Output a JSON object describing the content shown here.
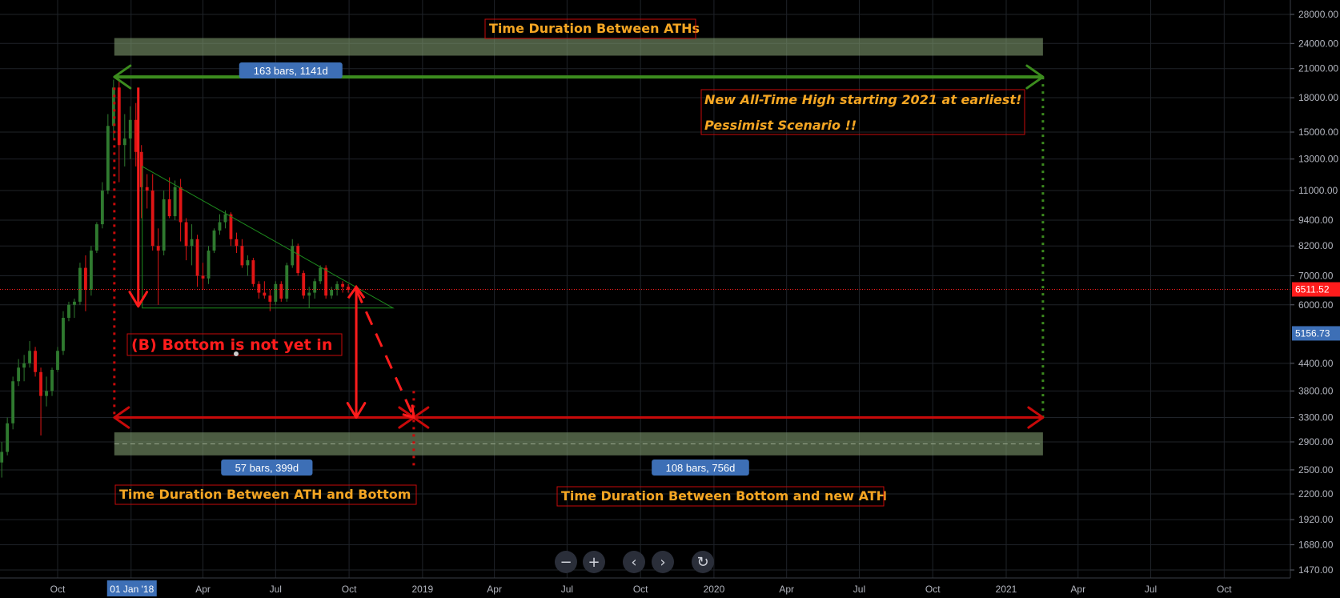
{
  "chart_data": {
    "type": "candlestick",
    "y_scale": "log",
    "ylim": [
      1400,
      30000
    ],
    "y_ticks": [
      {
        "value": 28000,
        "label": "28000.00"
      },
      {
        "value": 24000,
        "label": "24000.00"
      },
      {
        "value": 21000,
        "label": "21000.00"
      },
      {
        "value": 18000,
        "label": "18000.00"
      },
      {
        "value": 15000,
        "label": "15000.00"
      },
      {
        "value": 13000,
        "label": "13000.00"
      },
      {
        "value": 11000,
        "label": "11000.00"
      },
      {
        "value": 9400,
        "label": "9400.00"
      },
      {
        "value": 8200,
        "label": "8200.00"
      },
      {
        "value": 7000,
        "label": "7000.00"
      },
      {
        "value": 6000,
        "label": "6000.00"
      },
      {
        "value": 4400,
        "label": "4400.00"
      },
      {
        "value": 3800,
        "label": "3800.00"
      },
      {
        "value": 3300,
        "label": "3300.00"
      },
      {
        "value": 2900,
        "label": "2900.00"
      },
      {
        "value": 2500,
        "label": "2500.00"
      },
      {
        "value": 2200,
        "label": "2200.00"
      },
      {
        "value": 1920,
        "label": "1920.00"
      },
      {
        "value": 1680,
        "label": "1680.00"
      },
      {
        "value": 1470,
        "label": "1470.00"
      }
    ],
    "x_ticks": [
      {
        "date": "2017-10-01",
        "label": "Oct"
      },
      {
        "date": "2018-01-01",
        "label": "01 Jan '18",
        "highlight": true
      },
      {
        "date": "2018-04-01",
        "label": "Apr"
      },
      {
        "date": "2018-07-01",
        "label": "Jul"
      },
      {
        "date": "2018-10-01",
        "label": "Oct"
      },
      {
        "date": "2019-01-01",
        "label": "2019"
      },
      {
        "date": "2019-04-01",
        "label": "Apr"
      },
      {
        "date": "2019-07-01",
        "label": "Jul"
      },
      {
        "date": "2019-10-01",
        "label": "Oct"
      },
      {
        "date": "2020-01-01",
        "label": "2020"
      },
      {
        "date": "2020-04-01",
        "label": "Apr"
      },
      {
        "date": "2020-07-01",
        "label": "Jul"
      },
      {
        "date": "2020-10-01",
        "label": "Oct"
      },
      {
        "date": "2021-01-01",
        "label": "2021"
      },
      {
        "date": "2021-04-01",
        "label": "Apr"
      },
      {
        "date": "2021-07-01",
        "label": "Jul"
      },
      {
        "date": "2021-10-01",
        "label": "Oct"
      }
    ],
    "price_labels": [
      {
        "value": 6511.52,
        "label": "6511.52",
        "color": "#ff1c1c"
      },
      {
        "value": 5156.73,
        "label": "5156.73",
        "color": "#3d6fb6"
      }
    ],
    "candles": [
      {
        "date": "2017-07-23",
        "o": 2600,
        "h": 2900,
        "l": 2400,
        "c": 2750
      },
      {
        "date": "2017-07-30",
        "o": 2750,
        "h": 3300,
        "l": 2700,
        "c": 3200
      },
      {
        "date": "2017-08-06",
        "o": 3200,
        "h": 4100,
        "l": 3100,
        "c": 4000
      },
      {
        "date": "2017-08-13",
        "o": 4000,
        "h": 4500,
        "l": 3900,
        "c": 4300
      },
      {
        "date": "2017-08-20",
        "o": 4300,
        "h": 4600,
        "l": 4000,
        "c": 4400
      },
      {
        "date": "2017-08-27",
        "o": 4400,
        "h": 4950,
        "l": 4300,
        "c": 4700
      },
      {
        "date": "2017-09-03",
        "o": 4700,
        "h": 4800,
        "l": 4100,
        "c": 4200
      },
      {
        "date": "2017-09-10",
        "o": 4200,
        "h": 4300,
        "l": 3000,
        "c": 3700
      },
      {
        "date": "2017-09-17",
        "o": 3700,
        "h": 4100,
        "l": 3500,
        "c": 3800
      },
      {
        "date": "2017-09-24",
        "o": 3800,
        "h": 4300,
        "l": 3700,
        "c": 4250
      },
      {
        "date": "2017-10-01",
        "o": 4250,
        "h": 4800,
        "l": 4200,
        "c": 4700
      },
      {
        "date": "2017-10-08",
        "o": 4700,
        "h": 5800,
        "l": 4600,
        "c": 5600
      },
      {
        "date": "2017-10-15",
        "o": 5600,
        "h": 6100,
        "l": 5500,
        "c": 6000
      },
      {
        "date": "2017-10-22",
        "o": 6000,
        "h": 6200,
        "l": 5600,
        "c": 6100
      },
      {
        "date": "2017-10-29",
        "o": 6100,
        "h": 7500,
        "l": 6000,
        "c": 7300
      },
      {
        "date": "2017-11-05",
        "o": 7300,
        "h": 7800,
        "l": 5800,
        "c": 6500
      },
      {
        "date": "2017-11-12",
        "o": 6500,
        "h": 8200,
        "l": 6300,
        "c": 8000
      },
      {
        "date": "2017-11-19",
        "o": 8000,
        "h": 9300,
        "l": 7900,
        "c": 9200
      },
      {
        "date": "2017-11-26",
        "o": 9200,
        "h": 11500,
        "l": 9000,
        "c": 11000
      },
      {
        "date": "2017-12-03",
        "o": 11000,
        "h": 16500,
        "l": 10800,
        "c": 15500
      },
      {
        "date": "2017-12-10",
        "o": 15500,
        "h": 19800,
        "l": 14500,
        "c": 19000
      },
      {
        "date": "2017-12-17",
        "o": 19000,
        "h": 19700,
        "l": 11500,
        "c": 14000
      },
      {
        "date": "2017-12-24",
        "o": 14000,
        "h": 16500,
        "l": 12500,
        "c": 14500
      },
      {
        "date": "2017-12-31",
        "o": 14500,
        "h": 17200,
        "l": 13000,
        "c": 16000
      },
      {
        "date": "2018-01-07",
        "o": 16000,
        "h": 17500,
        "l": 12500,
        "c": 13500
      },
      {
        "date": "2018-01-14",
        "o": 13500,
        "h": 14000,
        "l": 9500,
        "c": 11200
      },
      {
        "date": "2018-01-21",
        "o": 11200,
        "h": 12000,
        "l": 10000,
        "c": 11000
      },
      {
        "date": "2018-01-28",
        "o": 11000,
        "h": 12000,
        "l": 8000,
        "c": 8200
      },
      {
        "date": "2018-02-04",
        "o": 8200,
        "h": 9000,
        "l": 6000,
        "c": 8000
      },
      {
        "date": "2018-02-11",
        "o": 8000,
        "h": 11000,
        "l": 7800,
        "c": 10500
      },
      {
        "date": "2018-02-18",
        "o": 10500,
        "h": 11800,
        "l": 9500,
        "c": 9600
      },
      {
        "date": "2018-02-25",
        "o": 9600,
        "h": 11600,
        "l": 9400,
        "c": 11200
      },
      {
        "date": "2018-03-04",
        "o": 11200,
        "h": 11700,
        "l": 8400,
        "c": 9300
      },
      {
        "date": "2018-03-11",
        "o": 9300,
        "h": 9500,
        "l": 7600,
        "c": 8200
      },
      {
        "date": "2018-03-18",
        "o": 8200,
        "h": 9200,
        "l": 7400,
        "c": 8500
      },
      {
        "date": "2018-03-25",
        "o": 8500,
        "h": 8700,
        "l": 6600,
        "c": 7000
      },
      {
        "date": "2018-04-01",
        "o": 7000,
        "h": 7500,
        "l": 6500,
        "c": 6900
      },
      {
        "date": "2018-04-08",
        "o": 6900,
        "h": 8200,
        "l": 6700,
        "c": 8000
      },
      {
        "date": "2018-04-15",
        "o": 8000,
        "h": 9000,
        "l": 7900,
        "c": 8900
      },
      {
        "date": "2018-04-22",
        "o": 8900,
        "h": 9700,
        "l": 8700,
        "c": 9300
      },
      {
        "date": "2018-04-29",
        "o": 9300,
        "h": 9900,
        "l": 9000,
        "c": 9700
      },
      {
        "date": "2018-05-06",
        "o": 9700,
        "h": 9800,
        "l": 8200,
        "c": 8500
      },
      {
        "date": "2018-05-13",
        "o": 8500,
        "h": 8800,
        "l": 7900,
        "c": 8200
      },
      {
        "date": "2018-05-20",
        "o": 8200,
        "h": 8500,
        "l": 7300,
        "c": 7400
      },
      {
        "date": "2018-05-27",
        "o": 7400,
        "h": 7800,
        "l": 7000,
        "c": 7600
      },
      {
        "date": "2018-06-03",
        "o": 7600,
        "h": 7700,
        "l": 6600,
        "c": 6700
      },
      {
        "date": "2018-06-10",
        "o": 6700,
        "h": 6800,
        "l": 6200,
        "c": 6400
      },
      {
        "date": "2018-06-17",
        "o": 6400,
        "h": 6800,
        "l": 6200,
        "c": 6300
      },
      {
        "date": "2018-06-24",
        "o": 6300,
        "h": 6500,
        "l": 5800,
        "c": 6100
      },
      {
        "date": "2018-07-01",
        "o": 6100,
        "h": 6800,
        "l": 6000,
        "c": 6700
      },
      {
        "date": "2018-07-08",
        "o": 6700,
        "h": 6800,
        "l": 6100,
        "c": 6200
      },
      {
        "date": "2018-07-15",
        "o": 6200,
        "h": 7500,
        "l": 6100,
        "c": 7400
      },
      {
        "date": "2018-07-22",
        "o": 7400,
        "h": 8500,
        "l": 7300,
        "c": 8200
      },
      {
        "date": "2018-07-29",
        "o": 8200,
        "h": 8300,
        "l": 7000,
        "c": 7100
      },
      {
        "date": "2018-08-05",
        "o": 7100,
        "h": 7200,
        "l": 6200,
        "c": 6300
      },
      {
        "date": "2018-08-12",
        "o": 6300,
        "h": 6600,
        "l": 5900,
        "c": 6400
      },
      {
        "date": "2018-08-19",
        "o": 6400,
        "h": 6900,
        "l": 6200,
        "c": 6800
      },
      {
        "date": "2018-08-26",
        "o": 6800,
        "h": 7400,
        "l": 6700,
        "c": 7300
      },
      {
        "date": "2018-09-02",
        "o": 7300,
        "h": 7400,
        "l": 6200,
        "c": 6300
      },
      {
        "date": "2018-09-09",
        "o": 6300,
        "h": 6600,
        "l": 6200,
        "c": 6500
      },
      {
        "date": "2018-09-16",
        "o": 6500,
        "h": 6800,
        "l": 6300,
        "c": 6700
      },
      {
        "date": "2018-09-23",
        "o": 6700,
        "h": 6800,
        "l": 6400,
        "c": 6600
      },
      {
        "date": "2018-09-30",
        "o": 6600,
        "h": 6700,
        "l": 6400,
        "c": 6500
      }
    ],
    "drawings": {
      "top_band": {
        "from": "2017-12-11",
        "to": "2021-02-16",
        "low": 22500,
        "high": 24700,
        "color": "#7f9a6e"
      },
      "bottom_band": {
        "from": "2017-12-11",
        "to": "2021-02-16",
        "low": 2700,
        "high": 3050,
        "color": "#7f9a6e"
      },
      "triangle": {
        "start": "2018-01-15",
        "apex": "2018-11-25",
        "upper_start": 12500,
        "lower": 5900,
        "color": "#1e8c1e"
      },
      "ath_range_arrow": {
        "from": "2017-12-11",
        "to": "2021-02-16",
        "value": 20100,
        "color": "#3c8c1e",
        "label": "163 bars, 1141d"
      },
      "bottom_range_arrow_left": {
        "from": "2017-12-11",
        "to": "2018-12-21",
        "value": 3300,
        "color": "#c80a0a",
        "label": "57 bars, 399d"
      },
      "bottom_range_arrow_right": {
        "from": "2018-12-21",
        "to": "2021-02-16",
        "value": 3300,
        "color": "#c80a0a",
        "label": "108 bars, 756d"
      },
      "drop_arrow_1": {
        "date": "2018-01-10",
        "from": 19000,
        "to": 5950
      },
      "drop_arrow_2": {
        "date": "2018-10-10",
        "from": 6600,
        "to": 3300
      },
      "projection": {
        "from_date": "2018-10-10",
        "from_value": 6500,
        "to_date": "2018-12-21",
        "to_value": 3300
      },
      "vline_left": {
        "date": "2017-12-11",
        "from": 19000,
        "to": 3300,
        "color": "#c80a0a"
      },
      "vline_mid": {
        "date": "2018-12-21",
        "from": 3800,
        "to": 2500,
        "color": "#c80a0a"
      },
      "vline_right": {
        "date": "2021-02-16",
        "from": 20100,
        "to": 3300,
        "color": "#3c8c1e"
      },
      "current_price_line": {
        "value": 6511.52,
        "color": "#ff1c1c"
      }
    },
    "annotations": [
      {
        "text": "Time Duration Between ATHs",
        "color": "#f5a623"
      },
      {
        "text": "New All-Time High starting 2021 at earliest!",
        "color": "#f5a623"
      },
      {
        "text": "Pessimist Scenario !!",
        "color": "#f5a623"
      },
      {
        "text": "(B) Bottom is not yet in",
        "color": "#ff1c1c"
      },
      {
        "text": "Time Duration Between ATH and Bottom",
        "color": "#f5a623"
      },
      {
        "text": "Time Duration Between Bottom and new ATH",
        "color": "#f5a623"
      }
    ],
    "grid": true
  },
  "nav": {
    "zoom_out": "−",
    "zoom_in": "+",
    "scroll_left": "‹",
    "scroll_right": "›",
    "reset": "↻"
  }
}
